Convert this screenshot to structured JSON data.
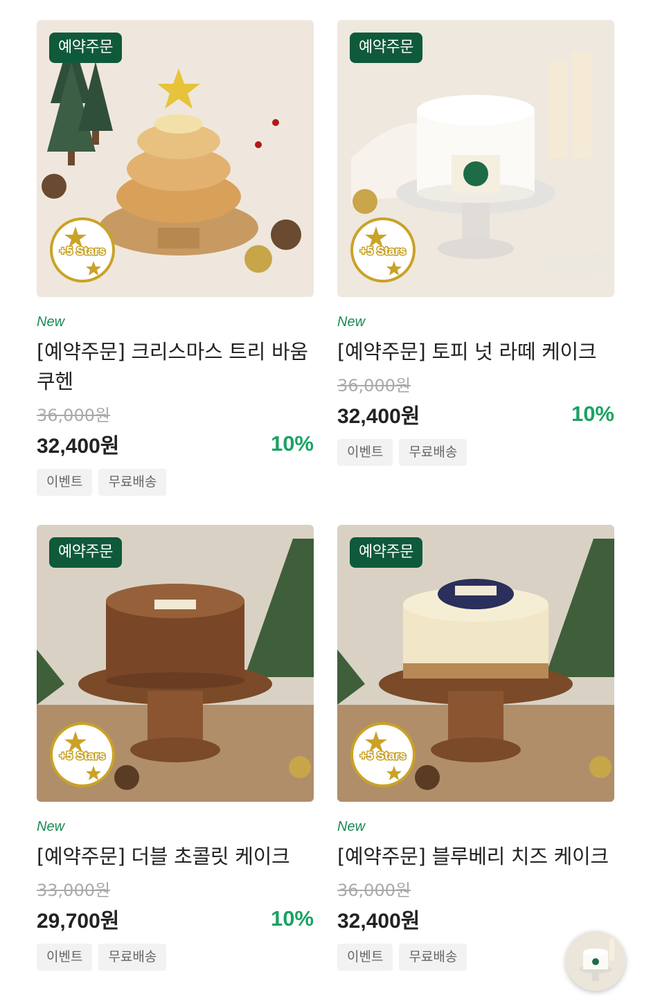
{
  "products": [
    {
      "badge": "예약주문",
      "stars_badge": "+5 Stars",
      "new_label": "New",
      "name": "[예약주문] 크리스마스 트리 바움쿠헨",
      "original_price": "36,000원",
      "price": "32,400원",
      "discount": "10%",
      "tags": [
        "이벤트",
        "무료배송"
      ]
    },
    {
      "badge": "예약주문",
      "stars_badge": "+5 Stars",
      "new_label": "New",
      "name": "[예약주문] 토피 넛 라떼 케이크",
      "original_price": "36,000원",
      "price": "32,400원",
      "discount": "10%",
      "tags": [
        "이벤트",
        "무료배송"
      ]
    },
    {
      "badge": "예약주문",
      "stars_badge": "+5 Stars",
      "new_label": "New",
      "name": "[예약주문] 더블 초콜릿 케이크",
      "original_price": "33,000원",
      "price": "29,700원",
      "discount": "10%",
      "tags": [
        "이벤트",
        "무료배송"
      ]
    },
    {
      "badge": "예약주문",
      "stars_badge": "+5 Stars",
      "new_label": "New",
      "name": "[예약주문] 블루베리 치즈 케이크",
      "original_price": "36,000원",
      "price": "32,400원",
      "discount": "",
      "tags": [
        "이벤트",
        "무료배송"
      ]
    }
  ],
  "colors": {
    "badge_green": "#0f5a3a",
    "new_green": "#1a8a52",
    "discount_green": "#1aa263",
    "stars_gold": "#c9a227"
  }
}
